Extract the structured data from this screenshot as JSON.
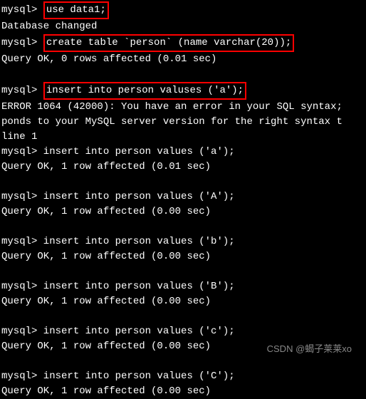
{
  "lines": {
    "l1_prompt": "mysql>",
    "l1_cmd": "use data1;",
    "l2": "Database changed",
    "l3_prompt": "mysql>",
    "l3_cmd": "create table `person` (name varchar(20));",
    "l4": "Query OK, 0 rows affected (0.01 sec)",
    "l5_prompt": "mysql>",
    "l5_cmd": "insert into person valuses ('a');",
    "l6": "ERROR 1064 (42000): You have an error in your SQL syntax;",
    "l7": "ponds to your MySQL server version for the right syntax t",
    "l8": " line 1",
    "l9": "mysql> insert into person values ('a');",
    "l10": "Query OK, 1 row affected (0.01 sec)",
    "l11": "mysql> insert into person values ('A');",
    "l12": "Query OK, 1 row affected (0.00 sec)",
    "l13": "mysql> insert into person values ('b');",
    "l14": "Query OK, 1 row affected (0.00 sec)",
    "l15": "mysql> insert into person values ('B');",
    "l16": "Query OK, 1 row affected (0.00 sec)",
    "l17": "mysql> insert into person values ('c');",
    "l18": "Query OK, 1 row affected (0.00 sec)",
    "l19": "mysql> insert into person values ('C');",
    "l20": "Query OK, 1 row affected (0.00 sec)"
  },
  "watermark": "CSDN @蝎子莱莱xo"
}
